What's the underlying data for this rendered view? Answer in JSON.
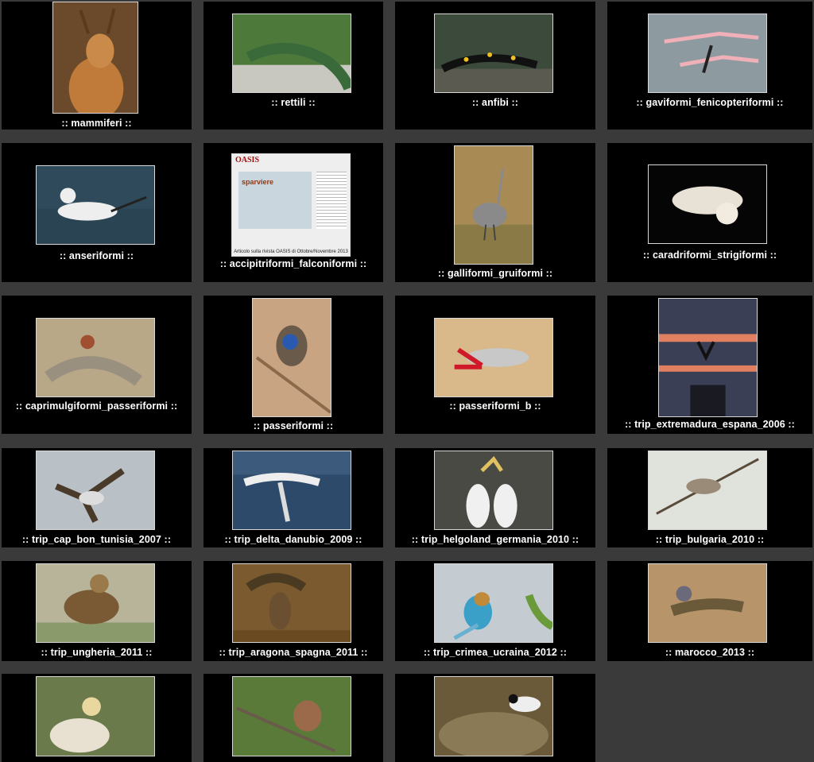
{
  "gallery": {
    "items": [
      {
        "caption": ":: mammiferi ::",
        "icon": "deer-photo-thumbnail",
        "bg": "#6a4a2a"
      },
      {
        "caption": ":: rettili ::",
        "icon": "lizard-photo-thumbnail",
        "bg": "#4d7a3a"
      },
      {
        "caption": ":: anfibi ::",
        "icon": "salamander-photo-thumbnail",
        "bg": "#3b4a3a"
      },
      {
        "caption": ":: gaviformi_fenicopteriformi ::",
        "icon": "flamingo-photo-thumbnail",
        "bg": "#8d9aa0"
      },
      {
        "caption": ":: anseriformi ::",
        "icon": "duck-photo-thumbnail",
        "bg": "#2f4a5a"
      },
      {
        "caption": ":: accipitriformi_falconiformi ::",
        "icon": "magazine-article-thumbnail",
        "bg": "#eeeeee",
        "magazine": {
          "brand": "OASIS",
          "title": "sparviere",
          "note": "Articolo sulla rivista OASIS di Ottobre/Novembre 2013"
        }
      },
      {
        "caption": ":: galliformi_gruiformi ::",
        "icon": "crane-photo-thumbnail",
        "bg": "#a88a55"
      },
      {
        "caption": ":: caradriformi_strigiformi ::",
        "icon": "barn-owl-photo-thumbnail",
        "bg": "#050505"
      },
      {
        "caption": ":: caprimulgiformi_passeriformi ::",
        "icon": "waxwing-photo-thumbnail",
        "bg": "#b8a888"
      },
      {
        "caption": ":: passeriformi ::",
        "icon": "bluethroat-photo-thumbnail",
        "bg": "#c9a482"
      },
      {
        "caption": ":: passeriformi_b ::",
        "icon": "wallcreeper-photo-thumbnail",
        "bg": "#d9b98a"
      },
      {
        "caption": ":: trip_extremadura_espana_2006 ::",
        "icon": "stork-nest-photo-thumbnail",
        "bg": "#3a3f55"
      },
      {
        "caption": ":: trip_cap_bon_tunisia_2007 ::",
        "icon": "kite-photo-thumbnail",
        "bg": "#b9c0c6"
      },
      {
        "caption": ":: trip_delta_danubio_2009 ::",
        "icon": "pelican-photo-thumbnail",
        "bg": "#3c5a7c"
      },
      {
        "caption": ":: trip_helgoland_germania_2010 ::",
        "icon": "gannet-photo-thumbnail",
        "bg": "#4a4a45"
      },
      {
        "caption": ":: trip_bulgaria_2010 ::",
        "icon": "warbler-photo-thumbnail",
        "bg": "#dfe3dc"
      },
      {
        "caption": ":: trip_ungheria_2011 ::",
        "icon": "eagle-photo-thumbnail",
        "bg": "#b8b49a"
      },
      {
        "caption": ":: trip_aragona_spagna_2011 ::",
        "icon": "owl-prey-photo-thumbnail",
        "bg": "#7a5a2e"
      },
      {
        "caption": ":: trip_crimea_ucraina_2012 ::",
        "icon": "roller-photo-thumbnail",
        "bg": "#c4ccd2"
      },
      {
        "caption": ":: marocco_2013 ::",
        "icon": "agama-photo-thumbnail",
        "bg": "#b8946a"
      },
      {
        "caption": "",
        "icon": "vulture-photo-thumbnail",
        "bg": "#6a7a4a"
      },
      {
        "caption": "",
        "icon": "robin-photo-thumbnail",
        "bg": "#5a7a3a"
      },
      {
        "caption": "",
        "icon": "wagtail-photo-thumbnail",
        "bg": "#6a5a3a"
      }
    ]
  },
  "colors": {
    "page_bg": "#3a3a3a",
    "cell_bg": "#000000",
    "caption": "#ffffff",
    "thumb_border": "#d8d8d8"
  }
}
